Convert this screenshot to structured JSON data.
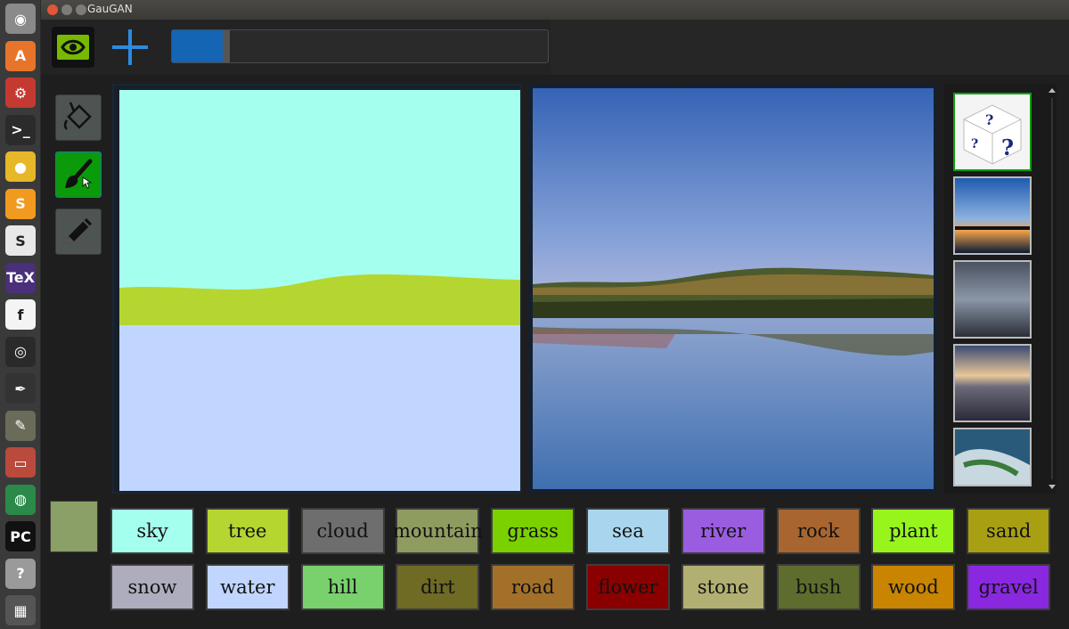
{
  "window": {
    "title": "GauGAN"
  },
  "launcher": {
    "items": [
      {
        "name": "ubuntu-dash-icon",
        "glyph": "◉",
        "bg": "#8a8a8a"
      },
      {
        "name": "software-center-icon",
        "glyph": "A",
        "bg": "#e8742a"
      },
      {
        "name": "system-settings-icon",
        "glyph": "⚙",
        "bg": "#c43a31"
      },
      {
        "name": "terminal-icon",
        "glyph": ">_",
        "bg": "#2b2b2b"
      },
      {
        "name": "chrome-icon",
        "glyph": "●",
        "bg": "#e7b72a"
      },
      {
        "name": "sublime-text-icon",
        "glyph": "S",
        "bg": "#f29a20"
      },
      {
        "name": "slack-icon",
        "glyph": "S",
        "bg": "#e8e8e8"
      },
      {
        "name": "texstudio-icon",
        "glyph": "TeX",
        "bg": "#4a2f7a"
      },
      {
        "name": "font-viewer-icon",
        "glyph": "f",
        "bg": "#f4f4f4"
      },
      {
        "name": "camera-icon",
        "glyph": "◎",
        "bg": "#2a2a2a"
      },
      {
        "name": "inkscape-icon",
        "glyph": "✒",
        "bg": "#333"
      },
      {
        "name": "gimp-icon",
        "glyph": "✎",
        "bg": "#6b6b5a"
      },
      {
        "name": "file-manager-icon",
        "glyph": "▭",
        "bg": "#b94a3c"
      },
      {
        "name": "shotwell-icon",
        "glyph": "◍",
        "bg": "#2b8a4a"
      },
      {
        "name": "pycharm-icon",
        "glyph": "PC",
        "bg": "#111"
      },
      {
        "name": "help-icon",
        "glyph": "?",
        "bg": "#9a9a9a"
      },
      {
        "name": "workspace-switcher-icon",
        "glyph": "▦",
        "bg": "#555"
      }
    ]
  },
  "palette": {
    "row1": [
      {
        "label": "sky",
        "color": "#a5ffee"
      },
      {
        "label": "tree",
        "color": "#b5d630"
      },
      {
        "label": "cloud",
        "color": "#6e6e6e"
      },
      {
        "label": "mountain",
        "color": "#8e9c60"
      },
      {
        "label": "grass",
        "color": "#7bd000"
      },
      {
        "label": "sea",
        "color": "#a9d6ee"
      },
      {
        "label": "river",
        "color": "#9a5de0"
      },
      {
        "label": "rock",
        "color": "#a9652f"
      },
      {
        "label": "plant",
        "color": "#97f51c"
      },
      {
        "label": "sand",
        "color": "#a8a012"
      }
    ],
    "row2": [
      {
        "label": "snow",
        "color": "#aeadbd"
      },
      {
        "label": "water",
        "color": "#c0d6ff"
      },
      {
        "label": "hill",
        "color": "#78d16c"
      },
      {
        "label": "dirt",
        "color": "#6f6a24"
      },
      {
        "label": "road",
        "color": "#a3702a"
      },
      {
        "label": "flower",
        "color": "#8a0000"
      },
      {
        "label": "stone",
        "color": "#b1b072"
      },
      {
        "label": "bush",
        "color": "#5e6d2d"
      },
      {
        "label": "wood",
        "color": "#c98400"
      },
      {
        "label": "gravel",
        "color": "#8a28e0"
      }
    ]
  },
  "colors": {
    "accent_blue": "#1465b3",
    "nvidia_green": "#76b900",
    "selected_tool_bg": "#0a9a0a",
    "selected_style_border": "#0ca00c"
  },
  "toolbar": {
    "slider_value": 0.15
  }
}
